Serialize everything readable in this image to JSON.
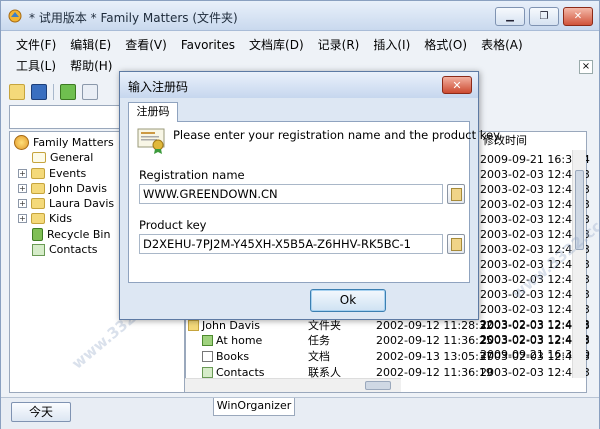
{
  "window": {
    "title": "* 试用版本 * Family Matters (文件夹)",
    "buttons": [
      "▁",
      "❐",
      "✕"
    ]
  },
  "menu": {
    "row1": [
      "文件(F)",
      "编辑(E)",
      "查看(V)",
      "Favorites",
      "文档库(D)",
      "记录(R)",
      "插入(I)",
      "格式(O)",
      "表格(A)"
    ],
    "row2": [
      "工具(L)",
      "帮助(H)"
    ],
    "close": "×"
  },
  "tree": {
    "root": "Family Matters",
    "items": [
      {
        "label": "General",
        "expander": ""
      },
      {
        "label": "Events",
        "expander": "+"
      },
      {
        "label": "John Davis",
        "expander": "+"
      },
      {
        "label": "Laura Davis",
        "expander": "+"
      },
      {
        "label": "Kids",
        "expander": "+"
      },
      {
        "label": "Recycle Bin",
        "expander": ""
      },
      {
        "label": "Contacts",
        "expander": ""
      }
    ]
  },
  "grid": {
    "col_modified": "修改时间",
    "modified_times": [
      "2009-09-21 16:37:4",
      "2003-02-03 12:49:3",
      "2003-02-03 12:49:3",
      "2003-02-03 12:49:3",
      "2003-02-03 12:49:3",
      "2003-02-03 12:49:3",
      "2003-02-03 12:49:3",
      "2003-02-03 12:49:3",
      "2003-02-03 12:49:3",
      "2003-02-03 12:49:3",
      "2003-02-03 12:49:3",
      "2003-02-03 12:49:3",
      "2003-02-03 12:49:3",
      "2009-09-21 16:38:0"
    ],
    "rows": [
      {
        "name": "John Davis",
        "type": "文件夹",
        "created": "2002-09-12 11:28:32",
        "modified": "2003-02-03 12:49:3"
      },
      {
        "name": "At home",
        "type": "任务",
        "created": "2002-09-12 11:36:25",
        "modified": "2003-02-03 12:49:3"
      },
      {
        "name": "Books",
        "type": "文档",
        "created": "2002-09-13 13:05:37",
        "modified": "2003-02-03 12:49:3"
      },
      {
        "name": "Contacts",
        "type": "联系人",
        "created": "2002-09-12 11:36:19",
        "modified": "2003-02-03 12:49:3"
      }
    ]
  },
  "status": {
    "today_button": "今天",
    "tab": "WinOrganizer"
  },
  "watermark": "3322下载站",
  "watermark_url": "www.3322.cc",
  "dialog": {
    "title": "输入注册码",
    "close": "✕",
    "tab": "注册码",
    "message": "Please enter your registration name and the product key.",
    "name_label": "Registration name",
    "name_value": "WWW.GREENDOWN.CN",
    "key_label": "Product key",
    "key_value": "D2XEHU-7PJ2M-Y45XH-X5B5A-Z6HHV-RK5BC-1",
    "ok": "Ok"
  }
}
